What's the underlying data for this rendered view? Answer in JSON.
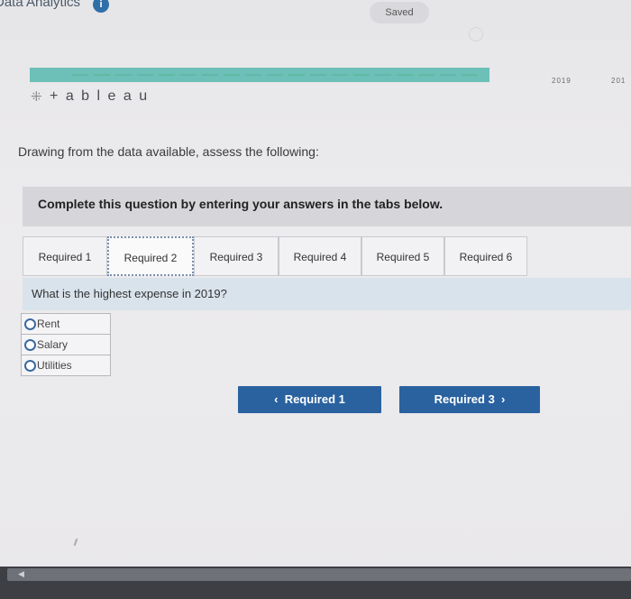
{
  "header": {
    "app_title": "Data Analytics",
    "info_badge": "i",
    "saved_label": "Saved",
    "year_labels": [
      "2019",
      "201"
    ]
  },
  "logo": {
    "mark": "⁜",
    "text": "+ a b l e a u"
  },
  "prompt": "Drawing from the data available, assess the following:",
  "instruction": "Complete this question by entering your answers in the tabs below.",
  "tabs": [
    {
      "label": "Required 1",
      "active": false
    },
    {
      "label": "Required 2",
      "active": true
    },
    {
      "label": "Required 3",
      "active": false
    },
    {
      "label": "Required 4",
      "active": false
    },
    {
      "label": "Required 5",
      "active": false
    },
    {
      "label": "Required 6",
      "active": false
    }
  ],
  "question": "What is the highest expense in 2019?",
  "options": [
    "Rent",
    "Salary",
    "Utilities"
  ],
  "nav": {
    "prev_label": "Required 1",
    "prev_icon": "chevron-left-icon",
    "next_label": "Required 3",
    "next_icon": "chevron-right-icon"
  },
  "colors": {
    "accent": "#2a62a0",
    "teal_bar": "#6cc0b8",
    "question_band": "#d9e3ec"
  }
}
